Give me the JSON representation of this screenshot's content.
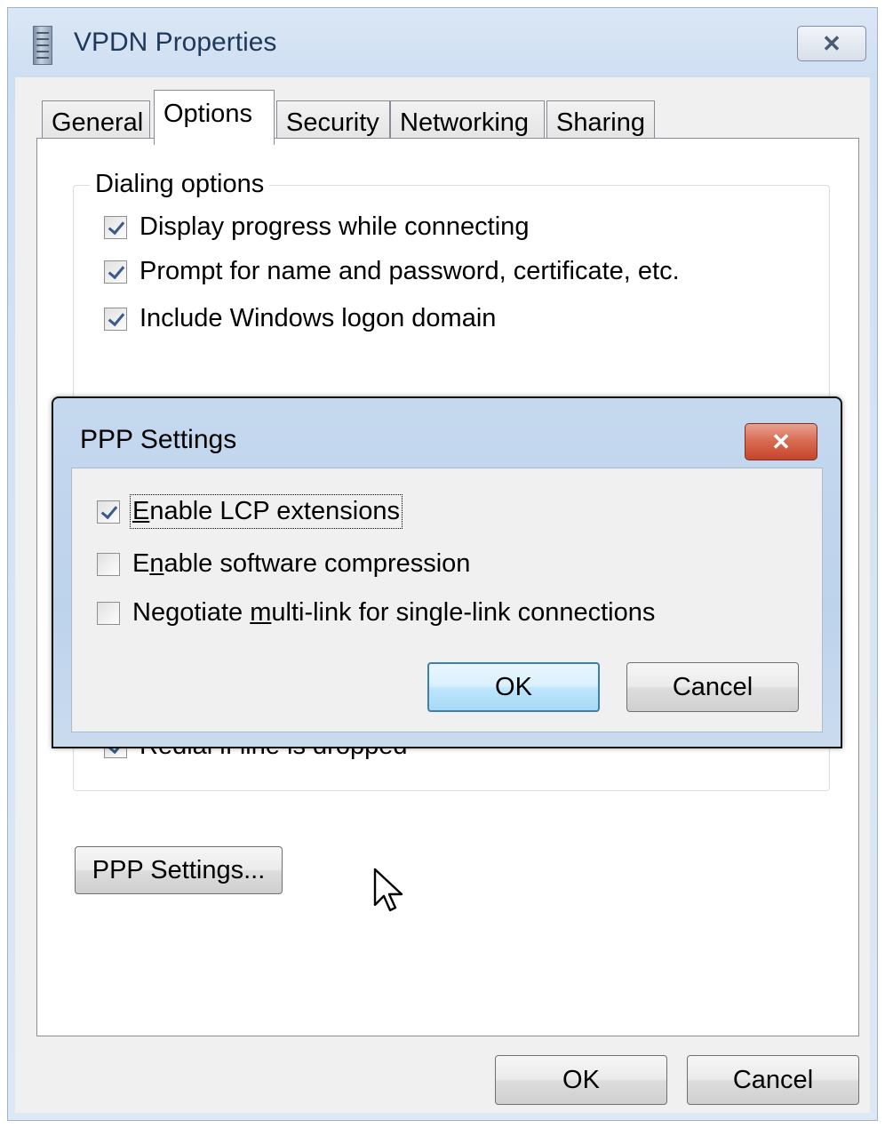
{
  "window": {
    "title": "VPDN Properties",
    "close_glyph": "✕"
  },
  "tabs": [
    {
      "label": "General",
      "active": false
    },
    {
      "label": "Options",
      "active": true
    },
    {
      "label": "Security",
      "active": false
    },
    {
      "label": "Networking",
      "active": false
    },
    {
      "label": "Sharing",
      "active": false
    }
  ],
  "dialing_options": {
    "legend": "Dialing options",
    "checkboxes": [
      {
        "label": "Display progress while connecting",
        "checked": true
      },
      {
        "label": "Prompt for name and password, certificate, etc.",
        "checked": true
      },
      {
        "label": "Include Windows logon domain",
        "checked": true
      }
    ],
    "partially_hidden_checkbox": {
      "label": "Redial if line is dropped",
      "checked": true
    }
  },
  "ppp_settings_button": "PPP Settings...",
  "footer": {
    "ok_label": "OK",
    "cancel_label": "Cancel"
  },
  "ppp_dialog": {
    "title": "PPP Settings",
    "close_glyph": "✕",
    "checkboxes": [
      {
        "prefix": "",
        "mnemonic": "E",
        "suffix": "nable LCP extensions",
        "checked": true
      },
      {
        "prefix": "E",
        "mnemonic": "n",
        "suffix": "able software compression",
        "checked": false
      },
      {
        "prefix": "Negotiate ",
        "mnemonic": "m",
        "suffix": "ulti-link for single-link connections",
        "checked": false
      }
    ],
    "ok_label": "OK",
    "cancel_label": "Cancel"
  },
  "colors": {
    "title_text": "#1e395b",
    "default_button_border": "#3c7fb1",
    "close_button_red": "#c4452b"
  },
  "icons": [
    "window-app-icon",
    "close-icon",
    "checkbox-check-icon",
    "mouse-pointer-icon"
  ]
}
